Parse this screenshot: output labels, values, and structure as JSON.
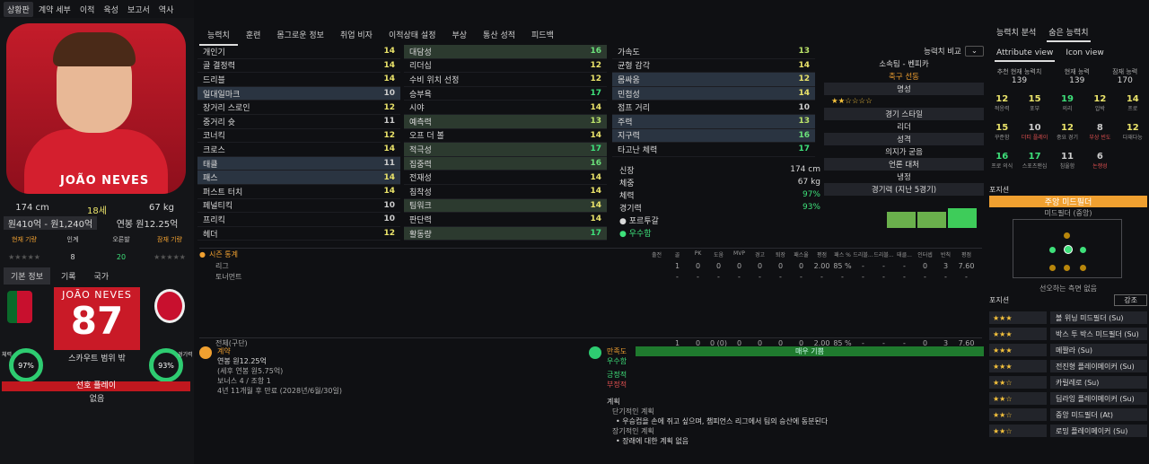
{
  "topnav": [
    "상황판",
    "계약 세부",
    "이적",
    "육성",
    "보고서",
    "역사"
  ],
  "left": {
    "height": "174 cm",
    "age": "18세",
    "weight": "67 kg",
    "value": "원410억 - 원1,240억",
    "wage": "연봉 원12.25억",
    "cur_label": "현재 기량",
    "pot_label": "잠재 기량",
    "right_label": "인계",
    "left_label": "오른발",
    "foot_l": "8",
    "foot_r": "20",
    "tabs": [
      "기본 정보",
      "기록",
      "국가"
    ],
    "card_name": "JOÃO NEVES",
    "card_num": "87",
    "card_sub": "스카우트 범위 밖",
    "ring_l": "97%",
    "ring_r": "93%",
    "ring_l_label": "체력",
    "ring_r_label": "경기력",
    "status": "선호 플레이",
    "status_val": "없음"
  },
  "tabs": [
    "능력치",
    "훈련",
    "몸그로운 정보",
    "취업 비자",
    "이적상태 설정",
    "부상",
    "통산 성적",
    "피드백"
  ],
  "col1": [
    [
      "개인기",
      "14"
    ],
    [
      "골 결정력",
      "14"
    ],
    [
      "드리블",
      "14"
    ],
    [
      "일대일마크",
      "10"
    ],
    [
      "장거리 스로인",
      "12"
    ],
    [
      "중거리 슛",
      "11"
    ],
    [
      "코너킥",
      "12"
    ],
    [
      "크로스",
      "14"
    ],
    [
      "태클",
      "11"
    ],
    [
      "패스",
      "14"
    ],
    [
      "퍼스트 터치",
      "14"
    ],
    [
      "페널티킥",
      "10"
    ],
    [
      "프리킥",
      "10"
    ],
    [
      "헤더",
      "12"
    ]
  ],
  "col1_hl": [
    3,
    8,
    9
  ],
  "col2": [
    [
      "대담성",
      "16"
    ],
    [
      "리더십",
      "12"
    ],
    [
      "수비 위치 선정",
      "12"
    ],
    [
      "승부욕",
      "17"
    ],
    [
      "시야",
      "14"
    ],
    [
      "예측력",
      "13"
    ],
    [
      "오프 더 볼",
      "14"
    ],
    [
      "적극성",
      "17"
    ],
    [
      "집중력",
      "16"
    ],
    [
      "전재성",
      "14"
    ],
    [
      "침착성",
      "14"
    ],
    [
      "팀워크",
      "14"
    ],
    [
      "판단력",
      "14"
    ],
    [
      "활동량",
      "17"
    ]
  ],
  "col2_hl": [
    0,
    5,
    7,
    8,
    11,
    13
  ],
  "col3": [
    [
      "가속도",
      "13"
    ],
    [
      "균형 감각",
      "14"
    ],
    [
      "몸싸움",
      "12"
    ],
    [
      "민첩성",
      "14"
    ],
    [
      "점프 거리",
      "10"
    ],
    [
      "주력",
      "13"
    ],
    [
      "지구력",
      "16"
    ],
    [
      "타고난 체력",
      "17"
    ]
  ],
  "col3_hl": [
    2,
    3,
    5,
    6
  ],
  "info": [
    [
      "신장",
      "174 cm"
    ],
    [
      "체중",
      "67 kg"
    ],
    [
      "체력",
      "97%"
    ],
    [
      "경기력",
      "93%"
    ]
  ],
  "nation": "포르투갈",
  "nation_state": "우수함",
  "rp": {
    "compare": "능력치 비교",
    "club": "소속팀 - 벤피카",
    "club_sub": "축구 선동",
    "rep_h": "명성",
    "style_h": "경기 스타일",
    "style_v": "리더",
    "pers_h": "성격",
    "pers_v": "의지가 굳음",
    "media_h": "언론 대처",
    "media_v": "냉정",
    "form_h": "경기력 (지난 5경기)"
  },
  "stats": {
    "title": "시즌 통계",
    "cols": [
      "출전",
      "골",
      "PK",
      "도움",
      "MVP",
      "경고",
      "퇴장",
      "패스율",
      "평점",
      "패스 %",
      "드리블...",
      "드리블...",
      "태클...",
      "인터셉",
      "반칙",
      "평점"
    ],
    "rows": [
      [
        "리그",
        "1",
        "0",
        "0",
        "0",
        "0",
        "0",
        "0",
        "2.00",
        "85 %",
        "-",
        "-",
        "-",
        "0",
        "3",
        "7.60"
      ],
      [
        "토너먼트",
        "-",
        "-",
        "-",
        "-",
        "-",
        "-",
        "-",
        "-",
        "-",
        "-",
        "-",
        "-",
        "-",
        "-",
        "-"
      ]
    ],
    "total": [
      "전체(구단)",
      "1",
      "0",
      "0 (0)",
      "0",
      "0",
      "0",
      "0",
      "2.00",
      "85 %",
      "-",
      "-",
      "-",
      "0",
      "3",
      "7.60"
    ]
  },
  "contract": {
    "title": "계약",
    "l1": "연봉 원12.25억",
    "l2": "(세후 연봉 원5.75억)",
    "l3": "보너스 4 / 조항 1",
    "l4": "4년 11개월 후 만료 (2028년/6월/30일)"
  },
  "happy": {
    "title": "만족도",
    "val": "우수함",
    "bar": "매우 기쁨",
    "pos": "긍정적",
    "neg": "부정적",
    "plan": "계획",
    "short": "단기적인 계획",
    "short_v": "우승컵을 손에 쥐고 싶으며, 챔피언스 리그에서 팀의 승산에 동분된다",
    "long": "장기적인 계획",
    "long_v": "장래에 대한 계획 없음"
  },
  "far": {
    "tabs": [
      "능력치 분석",
      "숨은 능력치"
    ],
    "views": [
      "Attribute view",
      "Icon view"
    ],
    "ability": [
      [
        "추천 현재 능력치",
        "139"
      ],
      [
        "현재 능력",
        "139"
      ],
      [
        "잠재 능력",
        "170"
      ]
    ],
    "g1": [
      [
        "12",
        "적응력"
      ],
      [
        "15",
        "포부"
      ],
      [
        "19",
        "의리"
      ],
      [
        "12",
        "압박"
      ],
      [
        "14",
        "프로"
      ]
    ],
    "g2": [
      [
        "15",
        "꾸준함"
      ],
      [
        "10",
        "더티 플레이"
      ],
      [
        "12",
        "중요 경기"
      ],
      [
        "8",
        "부상 빈도"
      ],
      [
        "12",
        "다재다능"
      ]
    ],
    "g3": [
      [
        "16",
        "프로 의식"
      ],
      [
        "17",
        "스포츠맨십"
      ],
      [
        "11",
        "침울함"
      ],
      [
        "6",
        "논쟁성"
      ]
    ],
    "pos_h": "포지션",
    "pos_v": "주앙 미드필더",
    "pos_sub": "미드필더 (중앙)",
    "pref": "선오하는 측면 없음",
    "role_h": "포지션",
    "role_sel": "강조",
    "roles": [
      "볼 위닝 미드필더 (Su)",
      "박스 투 박스 미드필더 (Su)",
      "메짤라 (Su)",
      "전진형 플레이메이커 (Su)",
      "카릴레로 (Su)",
      "딥라잉 플레이메이커 (Su)",
      "중앙 미드필더 (At)",
      "로밍 플레이메이커 (Su)"
    ],
    "stars": [
      "★★★",
      "★★★",
      "★★★",
      "★★★",
      "★★☆",
      "★★☆",
      "★★☆",
      "★★☆"
    ]
  }
}
